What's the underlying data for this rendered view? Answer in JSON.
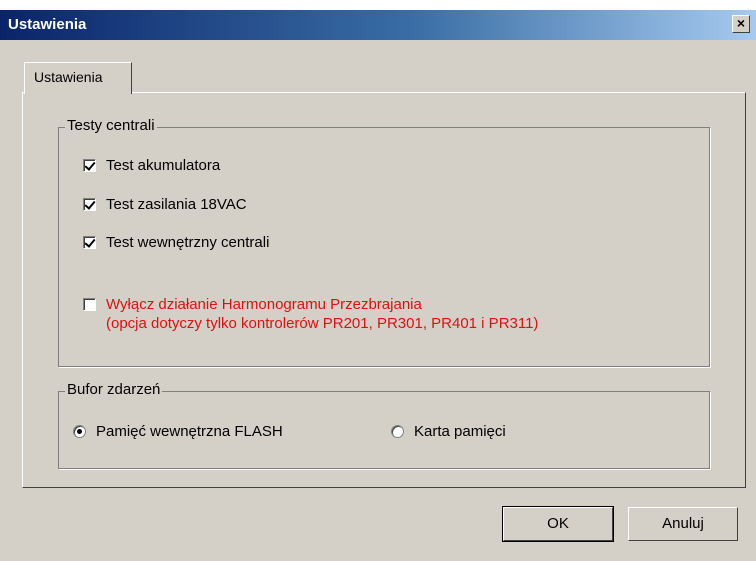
{
  "window": {
    "title": "Ustawienia",
    "close_glyph": "×"
  },
  "tab": {
    "label": "Ustawienia"
  },
  "tests_group": {
    "legend": "Testy centrali",
    "items": [
      {
        "label": "Test akumulatora",
        "checked": true
      },
      {
        "label": "Test zasilania 18VAC",
        "checked": true
      },
      {
        "label": "Test wewnętrzny centrali",
        "checked": true
      }
    ],
    "harmonogram": {
      "line1": "Wyłącz działanie Harmonogramu Przezbrajania",
      "line2": "(opcja dotyczy tylko kontrolerów PR201, PR301, PR401 i PR311)",
      "checked": false,
      "color": "#e01010"
    }
  },
  "buffer_group": {
    "legend": "Bufor zdarzeń",
    "options": [
      {
        "label": "Pamięć wewnętrzna FLASH",
        "selected": true
      },
      {
        "label": "Karta pamięci",
        "selected": false
      }
    ]
  },
  "buttons": {
    "ok": "OK",
    "cancel": "Anuluj"
  }
}
